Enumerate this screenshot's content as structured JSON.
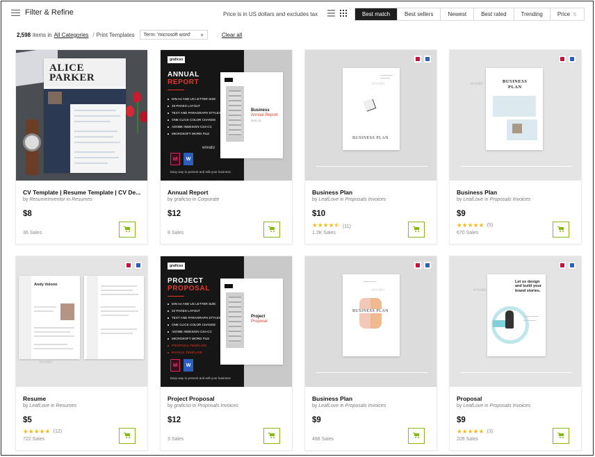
{
  "toolbar": {
    "filter_label": "Filter & Refine",
    "price_note": "Price is in US dollars and excludes tax",
    "sort_tabs": [
      "Best match",
      "Best sellers",
      "Newest",
      "Best rated",
      "Trending",
      "Price"
    ],
    "active_sort": "Best match"
  },
  "results": {
    "count": "2,598",
    "items_in": "items in",
    "category_link": "All Categories",
    "separator": "/",
    "subcategory": "Print Templates",
    "term_chip": "Term: 'microsoft word'",
    "term_close": "×",
    "clear_all": "Clear all"
  },
  "cards": [
    {
      "title": "CV Template | Resume Template | CV De...",
      "author": "ResumeInventor",
      "category": "Resumes",
      "price": "$8",
      "sales": "36 Sales",
      "rating_stars": "",
      "rating_count": ""
    },
    {
      "title": "Annual Report",
      "author": "graficso",
      "category": "Corporate",
      "price": "$12",
      "sales": "8 Sales",
      "rating_stars": "",
      "rating_count": ""
    },
    {
      "title": "Business Plan",
      "author": "LeafLove",
      "category": "Proposals Invoices",
      "price": "$10",
      "sales": "1.2K Sales",
      "rating_stars": "★★★★⯪",
      "rating_count": "(11)"
    },
    {
      "title": "Business Plan",
      "author": "LeafLove",
      "category": "Proposals Invoices",
      "price": "$9",
      "sales": "670 Sales",
      "rating_stars": "★★★★★",
      "rating_count": "(5)"
    },
    {
      "title": "Resume",
      "author": "LeafLove",
      "category": "Resumes",
      "price": "$5",
      "sales": "722 Sales",
      "rating_stars": "★★★★★",
      "rating_count": "(12)"
    },
    {
      "title": "Project Proposal",
      "author": "graficso",
      "category": "Proposals Invoices",
      "price": "$12",
      "sales": "3 Sales",
      "rating_stars": "",
      "rating_count": ""
    },
    {
      "title": "Business Plan",
      "author": "LeafLove",
      "category": "Proposals Invoices",
      "price": "$9",
      "sales": "488 Sales",
      "rating_stars": "",
      "rating_count": ""
    },
    {
      "title": "Proposal",
      "author": "LeafLove",
      "category": "Proposals Invoices",
      "price": "$9",
      "sales": "209 Sales",
      "rating_stars": "★★★★★",
      "rating_count": "(3)"
    }
  ],
  "byline": {
    "by": "by",
    "in": "in"
  },
  "thumbs": {
    "cv": {
      "name_first": "ALICE",
      "name_last": "PARKER"
    },
    "annual": {
      "brand": "graficso",
      "title_a": "ANNUAL",
      "title_b": "REPORT",
      "features": [
        "DIN A4 AND US LETTER SIZE",
        "48 PAGES LAYOUT",
        "TEXT AND PARAGRAPH STYLES",
        "ONE CLICK COLOR CHANGE",
        "ADOBE INDESIGN CS4-CC",
        "MICROSOFT WORD FILE"
      ],
      "footer": "Easy way to present and edit your business",
      "cover_a": "Business",
      "cover_b": "Annual Report",
      "cover_year": "2021-22"
    },
    "bp1": {
      "title": "BUSINESS PLAN"
    },
    "bp2": {
      "title_a": "BUSINESS",
      "title_b": "PLAN"
    },
    "resume": {
      "name": "Andy Volonn"
    },
    "proposal": {
      "brand": "graficso",
      "title_a": "PROJECT",
      "title_b": "PROPOSAL",
      "features": [
        "DIN A4 AND US LETTER SIZE",
        "22 PAGES LAYOUT",
        "TEXT AND PARAGRAPH STYLES",
        "ONE CLICK COLOR CHANGE",
        "ADOBE INDESIGN CS4-CC",
        "MICROSOFT WORD FILE",
        "PROPOSAL TEMPLATE",
        "INVOICE TEMPLATE"
      ],
      "footer": "Easy way to present and edit your business",
      "cover_a": "Project",
      "cover_b": "Proposal"
    },
    "bp3": {
      "title": "BUSINESS PLAN"
    },
    "prop": {
      "headline": "Let us design and build your brand stories."
    },
    "watermark": "envato",
    "app_id": "Id",
    "app_w": "W"
  },
  "colors": {
    "accent_green": "#86b817",
    "star": "#f5b90a",
    "report_red": "#e03a2b",
    "dark": "#1e1e1e"
  }
}
